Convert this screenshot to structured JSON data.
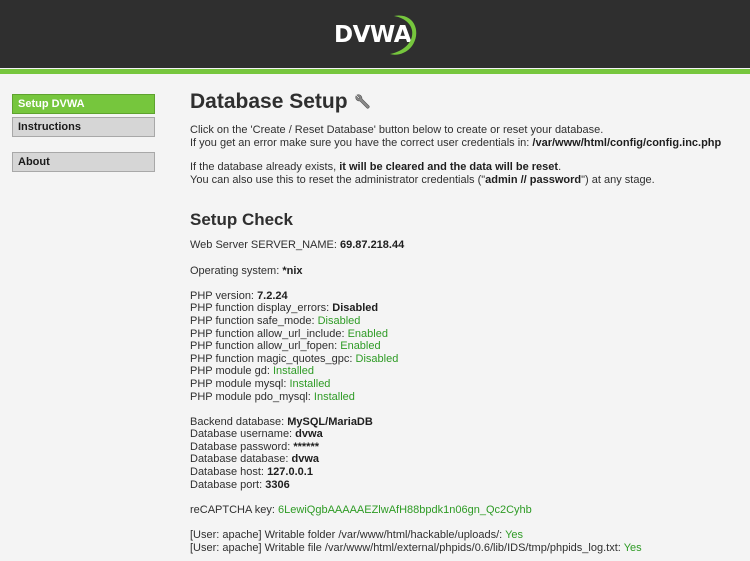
{
  "logo": {
    "text": "DVWA"
  },
  "colors": {
    "header_bg": "#2f2f2f",
    "accent": "#76c63d",
    "status_green": "#2e9b25",
    "page_bg": "#f4f4f4"
  },
  "sidebar": {
    "items": [
      {
        "label": "Setup DVWA",
        "active": true
      },
      {
        "label": "Instructions",
        "active": false
      },
      {
        "label": "About",
        "active": false
      }
    ]
  },
  "main": {
    "title": "Database Setup",
    "title_icon": "wrench-icon",
    "intro": {
      "line1": "Click on the 'Create / Reset Database' button below to create or reset your database.",
      "line2_prefix": "If you get an error make sure you have the correct user credentials in: ",
      "line2_path": "/var/www/html/config/config.inc.php",
      "line3_prefix": "If the database already exists, ",
      "line3_bold": "it will be cleared and the data will be reset",
      "line3_suffix": ".",
      "line4_prefix": "You can also use this to reset the administrator credentials (\"",
      "line4_bold": "admin // password",
      "line4_suffix": "\") at any stage."
    },
    "setup_check_title": "Setup Check",
    "server_name_label": "Web Server SERVER_NAME: ",
    "server_name_value": "69.87.218.44",
    "os_label": "Operating system: ",
    "os_value": "*nix",
    "php": [
      {
        "label": "PHP version: ",
        "value": "7.2.24",
        "style": "bold"
      },
      {
        "label": "PHP function display_errors: ",
        "value": "Disabled",
        "style": "bold"
      },
      {
        "label": "PHP function safe_mode: ",
        "value": "Disabled",
        "style": "green"
      },
      {
        "label": "PHP function allow_url_include: ",
        "value": "Enabled",
        "style": "green"
      },
      {
        "label": "PHP function allow_url_fopen: ",
        "value": "Enabled",
        "style": "green"
      },
      {
        "label": "PHP function magic_quotes_gpc: ",
        "value": "Disabled",
        "style": "green"
      },
      {
        "label": "PHP module gd: ",
        "value": "Installed",
        "style": "green"
      },
      {
        "label": "PHP module mysql: ",
        "value": "Installed",
        "style": "green"
      },
      {
        "label": "PHP module pdo_mysql: ",
        "value": "Installed",
        "style": "green"
      }
    ],
    "db": [
      {
        "label": "Backend database: ",
        "value": "MySQL/MariaDB"
      },
      {
        "label": "Database username: ",
        "value": "dvwa"
      },
      {
        "label": "Database password: ",
        "value": "******"
      },
      {
        "label": "Database database: ",
        "value": "dvwa"
      },
      {
        "label": "Database host: ",
        "value": "127.0.0.1"
      },
      {
        "label": "Database port: ",
        "value": "3306"
      }
    ],
    "recaptcha_label": "reCAPTCHA key: ",
    "recaptcha_value": "6LewiQgbAAAAAEZlwAfH88bpdk1n06gn_Qc2Cyhb",
    "writable": [
      {
        "label": "[User: apache] Writable folder /var/www/html/hackable/uploads/: ",
        "value": "Yes"
      },
      {
        "label": "[User: apache] Writable file /var/www/html/external/phpids/0.6/lib/IDS/tmp/phpids_log.txt: ",
        "value": "Yes"
      }
    ]
  }
}
